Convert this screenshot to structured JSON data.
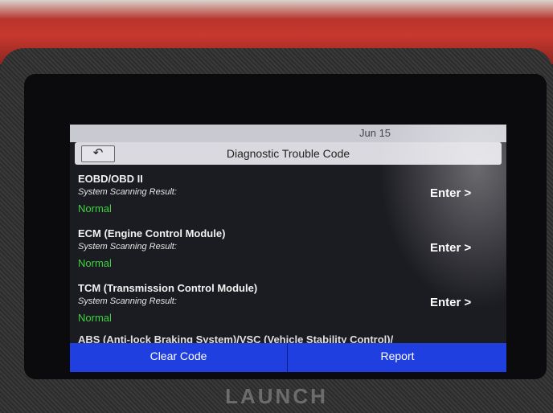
{
  "device": {
    "brand": "LAUNCH"
  },
  "status_bar": {
    "date": "Jun 15"
  },
  "header": {
    "back_icon": "↶",
    "title": "Diagnostic Trouble Code"
  },
  "systems": [
    {
      "name": "EOBD/OBD II",
      "subtitle": "System Scanning Result:",
      "status": "Normal",
      "action": "Enter >"
    },
    {
      "name": "ECM (Engine Control Module)",
      "subtitle": "System Scanning Result:",
      "status": "Normal",
      "action": "Enter >"
    },
    {
      "name": "TCM (Transmission Control Module)",
      "subtitle": "System Scanning Result:",
      "status": "Normal",
      "action": "Enter >"
    }
  ],
  "partial_item": {
    "name": "ABS (Anti-lock Braking System)/VSC (Vehicle Stability Control)/"
  },
  "footer": {
    "clear_label": "Clear Code",
    "report_label": "Report"
  },
  "colors": {
    "status_normal": "#3fd23f",
    "button_blue": "#1f3fe0",
    "case_red": "#c8382e"
  }
}
